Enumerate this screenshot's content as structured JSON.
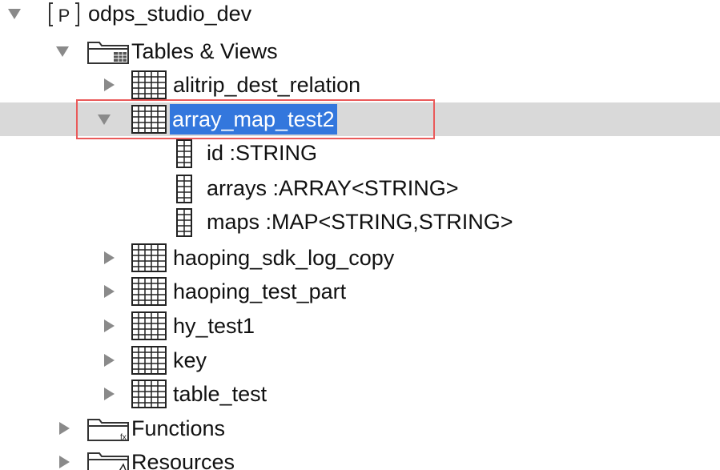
{
  "tree": {
    "project": {
      "label": "odps_studio_dev",
      "badge": "P",
      "expanded": true
    },
    "tables_views": {
      "label": "Tables & Views",
      "expanded": true
    },
    "tables": [
      {
        "label": "alitrip_dest_relation",
        "expanded": false
      },
      {
        "label": "array_map_test2",
        "expanded": true,
        "selected": true
      },
      {
        "label": "haoping_sdk_log_copy",
        "expanded": false
      },
      {
        "label": "haoping_test_part",
        "expanded": false
      },
      {
        "label": "hy_test1",
        "expanded": false
      },
      {
        "label": "key",
        "expanded": false
      },
      {
        "label": "table_test",
        "expanded": false
      }
    ],
    "columns": [
      {
        "label": "id :STRING"
      },
      {
        "label": "arrays :ARRAY<STRING>"
      },
      {
        "label": "maps :MAP<STRING,STRING>"
      }
    ],
    "functions": {
      "label": "Functions",
      "expanded": false
    },
    "resources": {
      "label": "Resources",
      "expanded": false
    }
  },
  "colors": {
    "selection_row": "#d9d9d9",
    "selection_text_bg": "#3377dd",
    "highlight_box": "#ea5a5a",
    "toggle": "#8a8a8a"
  },
  "icons": {
    "project": "project-icon",
    "folder": "folder-icon",
    "table": "table-icon",
    "column": "column-icon",
    "function": "function-folder-icon",
    "resource": "resource-folder-icon"
  }
}
